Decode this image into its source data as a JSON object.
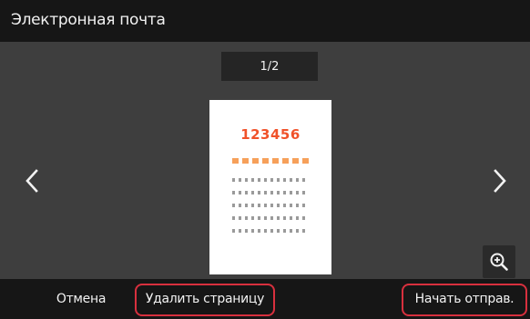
{
  "header": {
    "title": "Электронная почта"
  },
  "preview": {
    "page_indicator": "1/2",
    "page_number_text": "123456",
    "icons": {
      "prev": "chevron-left-icon",
      "next": "chevron-right-icon",
      "zoom": "zoom-in-icon"
    }
  },
  "footer": {
    "cancel_label": "Отмена",
    "delete_label": "Удалить страницу",
    "send_label": "Начать отправ."
  },
  "colors": {
    "accent_number": "#f0522a",
    "accent_dots": "#f6a05a",
    "callout_highlight": "#d8303e",
    "bar_background": "#161616",
    "content_background": "#3e3e3e"
  }
}
